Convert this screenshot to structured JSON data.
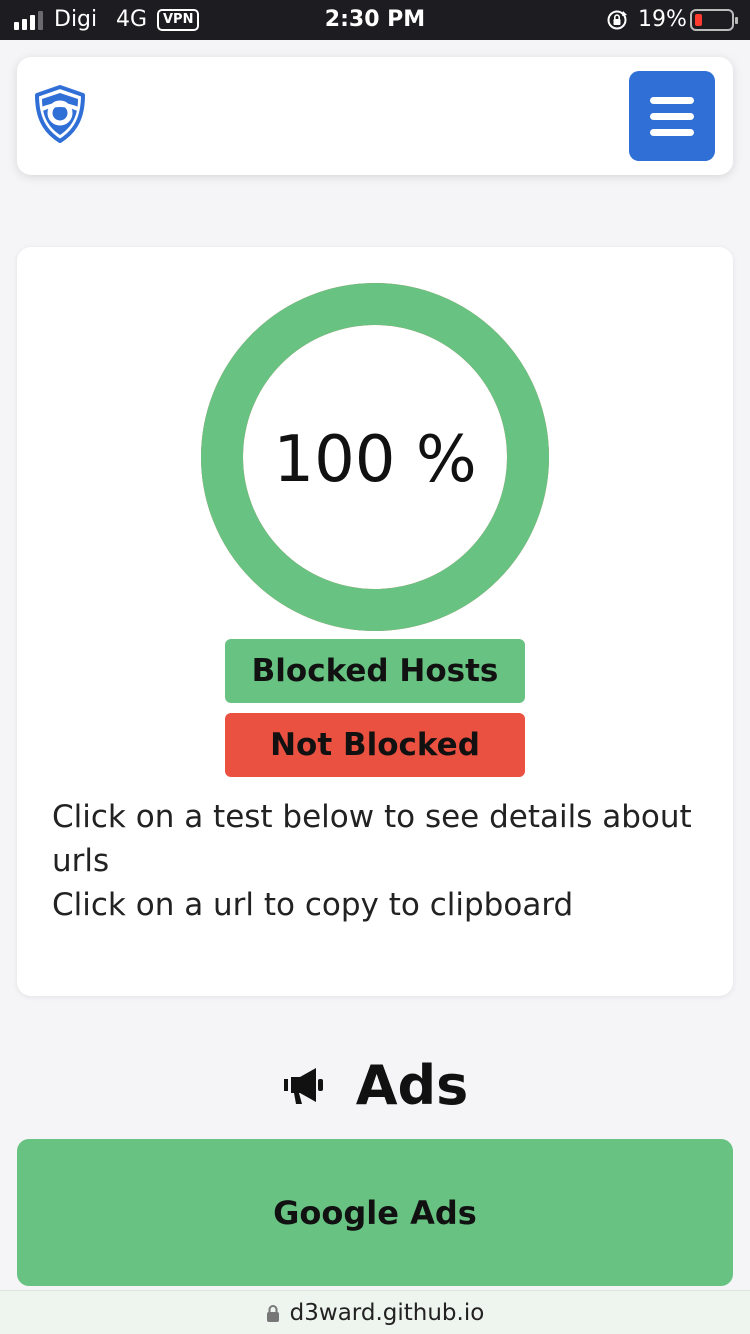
{
  "status_bar": {
    "carrier": "Digi",
    "network": "4G",
    "vpn": "VPN",
    "time": "2:30 PM",
    "battery_percent": "19%",
    "battery_level": 0.19,
    "signal_bars_active": 3,
    "signal_bars_total": 4,
    "rotation_lock_icon": "rotation-lock-icon"
  },
  "header": {
    "logo_icon": "shield-logo-icon",
    "menu_icon": "hamburger-menu-icon"
  },
  "result": {
    "percent_text": "100 %",
    "percent_value": 100,
    "legend_blocked": "Blocked Hosts",
    "legend_not_blocked": "Not Blocked",
    "instruction_line1": "Click on a test below to see details about urls",
    "instruction_line2": "Click on a url to copy to clipboard"
  },
  "section": {
    "icon": "megaphone-icon",
    "title": "Ads",
    "tests": [
      {
        "label": "Google Ads"
      }
    ]
  },
  "url_bar": {
    "icon": "lock-icon",
    "domain": "d3ward.github.io"
  },
  "colors": {
    "blocked": "#68c383",
    "not_blocked": "#eb5141",
    "accent": "#2f6fd6",
    "status_bar_bg": "#1c1c21"
  }
}
